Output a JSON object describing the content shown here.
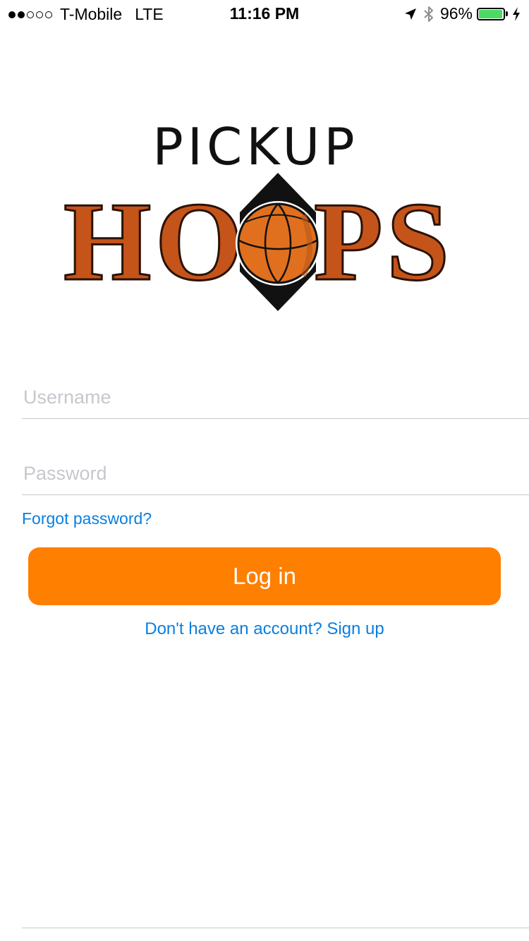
{
  "status_bar": {
    "signal_bars_filled": 2,
    "signal_bars_total": 5,
    "carrier": "T-Mobile",
    "network": "LTE",
    "time": "11:16 PM",
    "battery_percent": "96%",
    "battery_level": 0.96,
    "battery_color": "#4cd964"
  },
  "logo": {
    "top_text": "PICKUP",
    "main_text_letters": [
      "H",
      "O",
      "P",
      "S"
    ],
    "brand_color": "#c4541a"
  },
  "form": {
    "username_placeholder": "Username",
    "username_value": "",
    "password_placeholder": "Password",
    "password_value": ""
  },
  "links": {
    "forgot_password": "Forgot password?",
    "signup": "Don't have an account? Sign up",
    "link_color": "#0a7fe0"
  },
  "login_button": {
    "label": "Log in",
    "color": "#ff7f00"
  },
  "icons": [
    "location-arrow-icon",
    "bluetooth-icon",
    "battery-icon",
    "charging-bolt-icon"
  ]
}
